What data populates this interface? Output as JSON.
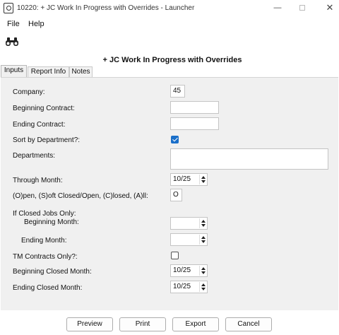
{
  "window": {
    "title": "10220: + JC Work In Progress with Overrides - Launcher",
    "minimize_glyph": "—",
    "close_glyph": "✕"
  },
  "menu": {
    "file": "File",
    "help": "Help"
  },
  "toolbar": {
    "icon": "binoculars-icon"
  },
  "form": {
    "title": "+ JC Work In Progress with Overrides"
  },
  "tabs": [
    {
      "label": "Inputs",
      "active": true
    },
    {
      "label": "Report Info",
      "active": false
    },
    {
      "label": "Notes",
      "active": false
    }
  ],
  "inputs": {
    "company": {
      "label": "Company:",
      "value": "45"
    },
    "beginning_contract": {
      "label": "Beginning Contract:",
      "value": ""
    },
    "ending_contract": {
      "label": "Ending Contract:",
      "value": ""
    },
    "sort_by_department": {
      "label": "Sort by Department?:",
      "checked": true
    },
    "departments": {
      "label": "Departments:",
      "value": ""
    },
    "through_month": {
      "label": "Through Month:",
      "value": "10/25"
    },
    "status": {
      "label": "(O)pen, (S)oft Closed/Open, (C)losed, (A)ll:",
      "value": "O"
    },
    "closed_jobs_header": "If Closed Jobs Only:",
    "beginning_month": {
      "label": "Beginning Month:",
      "value": ""
    },
    "ending_month": {
      "label": "Ending Month:",
      "value": ""
    },
    "tm_contracts_only": {
      "label": "TM Contracts Only?:",
      "checked": false
    },
    "beginning_closed_month": {
      "label": "Beginning Closed Month:",
      "value": "10/25"
    },
    "ending_closed_month": {
      "label": "Ending Closed Month:",
      "value": "10/25"
    }
  },
  "buttons": {
    "preview": "Preview",
    "print": "Print",
    "export": "Export",
    "cancel": "Cancel"
  },
  "colors": {
    "accent": "#1a6fc9",
    "panel": "#f0f0f0"
  }
}
